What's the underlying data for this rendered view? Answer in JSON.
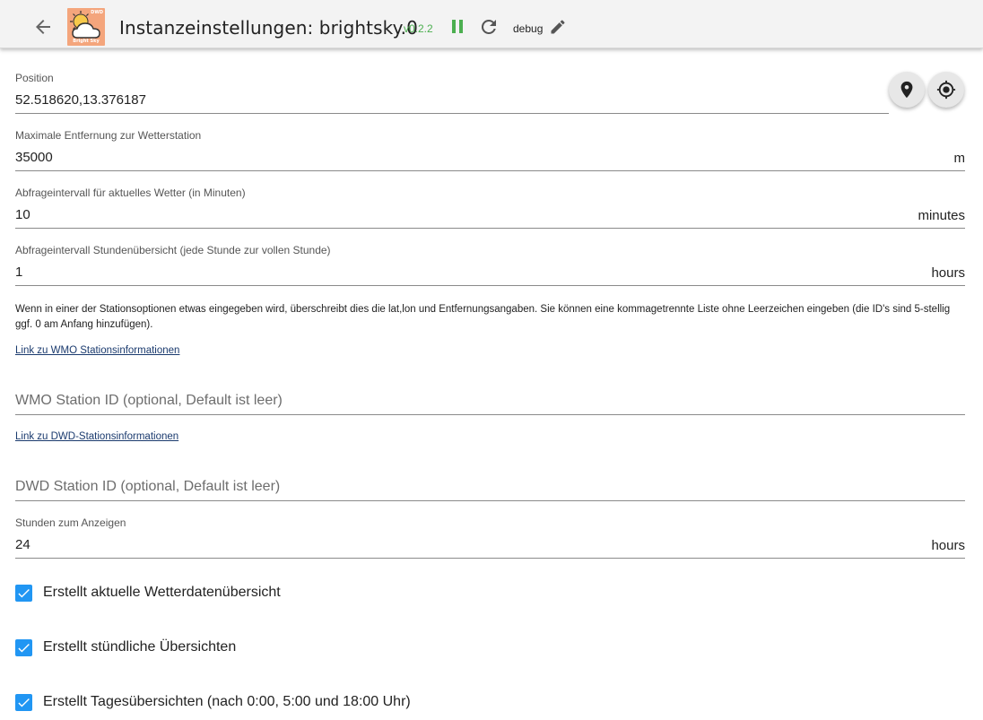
{
  "header": {
    "title": "Instanzeinstellungen: brightsky.0",
    "version": "v0.2.2",
    "loglevel": "debug",
    "logo_text": "Bright Sky",
    "logo_tag": "DWD"
  },
  "colors": {
    "accent": "#2196f3",
    "version": "#4caf50",
    "logo_bg": "#f4a57c",
    "link": "#1a3a6e"
  },
  "icons": {
    "back": "arrow-left-icon",
    "pause": "pause-icon",
    "refresh": "refresh-icon",
    "edit": "pencil-icon",
    "map": "map-marker-icon",
    "locate": "gps-fixed-icon",
    "checkbox": "check-icon"
  },
  "fields": {
    "position": {
      "label": "Position",
      "value": "52.518620,13.376187"
    },
    "max_distance": {
      "label": "Maximale Entfernung zur Wetterstation",
      "value": "35000",
      "unit": "m"
    },
    "current_interval": {
      "label": "Abfrageintervall für aktuelles Wetter (in Minuten)",
      "value": "10",
      "unit": "minutes"
    },
    "hourly_interval": {
      "label": "Abfrageintervall Stundenübersicht (jede Stunde zur vollen Stunde)",
      "value": "1",
      "unit": "hours"
    },
    "wmo_station": {
      "placeholder": "WMO Station ID (optional, Default ist leer)"
    },
    "dwd_station": {
      "placeholder": "DWD Station ID (optional, Default ist leer)"
    },
    "hours_to_show": {
      "label": "Stunden zum Anzeigen",
      "value": "24",
      "unit": "hours"
    }
  },
  "helptext": "Wenn in einer der Stationsoptionen etwas eingegeben wird, überschreibt dies die lat,lon und Entfernungsangaben. Sie können eine kommagetrennte Liste ohne Leerzeichen eingeben (die ID's sind 5-stellig ggf. 0 am Anfang hinzufügen).",
  "links": {
    "wmo": "Link zu WMO Stationsinformationen",
    "dwd": "Link zu DWD-Stationsinformationen"
  },
  "checkboxes": [
    {
      "label": "Erstellt aktuelle Wetterdatenübersicht",
      "checked": true
    },
    {
      "label": "Erstellt stündliche Übersichten",
      "checked": true
    },
    {
      "label": "Erstellt Tagesübersichten (nach 0:00, 5:00 und 18:00 Uhr)",
      "checked": true
    }
  ]
}
